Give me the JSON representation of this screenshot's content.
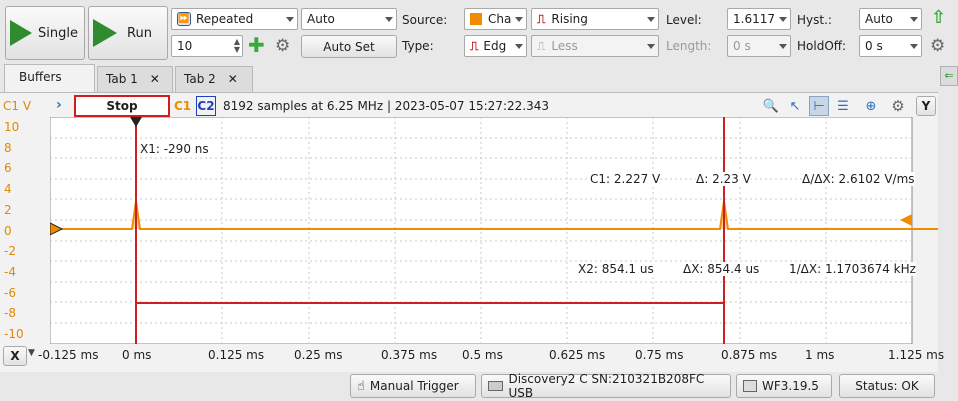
{
  "toolbar": {
    "single_label": "Single",
    "run_label": "Run",
    "mode_value": "Repeated",
    "auto_value": "Auto",
    "count_value": "10",
    "autoset_label": "Auto Set",
    "source_label": "Source:",
    "source_value": "Cha",
    "type_label": "Type:",
    "type_value": "Edg",
    "condition_value": "Rising",
    "condition2_value": "Less",
    "level_label": "Level:",
    "level_value": "1.6117",
    "length_label": "Length:",
    "length_value": "0 s",
    "hyst_label": "Hyst.:",
    "hyst_value": "Auto",
    "holdoff_label": "HoldOff:",
    "holdoff_value": "0 s"
  },
  "tabs": [
    {
      "label": "Buffers"
    },
    {
      "label": "Tab 1",
      "close": "✕"
    },
    {
      "label": "Tab 2",
      "close": "✕"
    }
  ],
  "scope": {
    "channel_label": "C1 V",
    "stop_label": "Stop",
    "c1_label": "C1",
    "c2_label": "C2",
    "info": "8192 samples at 6.25 MHz | 2023-05-07 15:27:22.343",
    "y_button": "Y",
    "x_button": "X",
    "colors": {
      "c1": "#f08c00",
      "cursor": "#cc1f1f",
      "c2": "#1f3fbf"
    }
  },
  "y_ticks": [
    "10",
    "8",
    "6",
    "4",
    "2",
    "0",
    "-2",
    "-4",
    "-6",
    "-8",
    "-10"
  ],
  "x_ticks": [
    "-0.125 ms",
    "0 ms",
    "0.125 ms",
    "0.25 ms",
    "0.375 ms",
    "0.5 ms",
    "0.625 ms",
    "0.75 ms",
    "0.875 ms",
    "1 ms",
    "1.125 ms"
  ],
  "measurements": {
    "x1": "X1: -290 ns",
    "c1": "C1: 2.227 V",
    "delta_v": "Δ: 2.23 V",
    "slope": "Δ/ΔX: 2.6102 V/ms",
    "x2": "X2: 854.1 us",
    "delta_x": "ΔX: 854.4 us",
    "freq": "1/ΔX: 1.1703674 kHz"
  },
  "status": {
    "manual_trigger": "Manual Trigger",
    "device": "Discovery2 C SN:210321B208FC USB",
    "version": "WF3.19.5",
    "status": "Status: OK"
  }
}
